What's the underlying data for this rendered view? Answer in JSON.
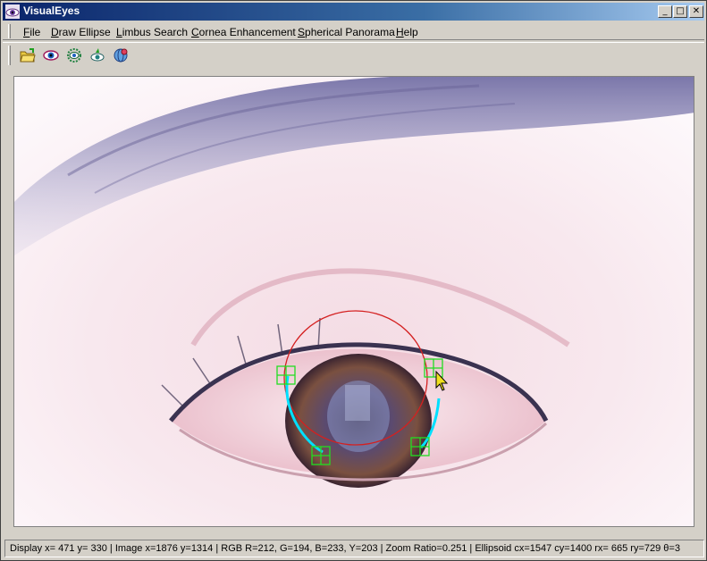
{
  "window": {
    "title": "VisualEyes",
    "minimize_glyph": "_",
    "maximize_glyph": "□",
    "close_glyph": "✕"
  },
  "menu": {
    "file": {
      "accel": "F",
      "rest": "ile"
    },
    "draw_ellipse": {
      "accel": "D",
      "rest": "raw Ellipse"
    },
    "limbus_search": {
      "accel": "L",
      "rest": "imbus Search"
    },
    "cornea_enhancement": {
      "accel": "C",
      "rest": "ornea Enhancement"
    },
    "spherical_panorama": {
      "accel": "S",
      "rest": "pherical Panorama"
    },
    "help": {
      "accel": "H",
      "rest": "elp"
    }
  },
  "toolbar": {
    "icons": [
      "open-folder-icon",
      "eye-icon",
      "gear-eye-icon",
      "eye-arrow-icon",
      "globe-eye-icon"
    ]
  },
  "colors": {
    "ellipse": "#d42020",
    "limbus_arc": "#00e0ff",
    "handles": "#22dd22"
  },
  "status": {
    "text": "Display x= 471 y= 330 | Image x=1876 y=1314 | RGB R=212, G=194, B=233, Y=203 | Zoom Ratio=0.251 | Ellipsoid cx=1547 cy=1400 rx= 665 ry=729 θ=3"
  }
}
